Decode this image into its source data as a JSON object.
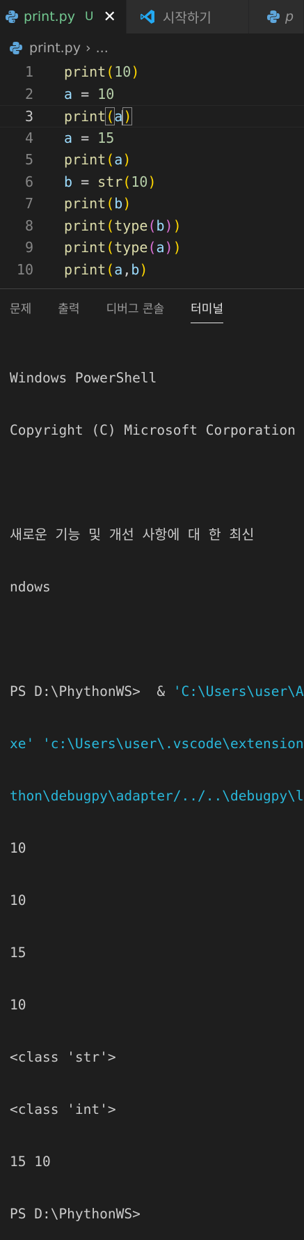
{
  "tabs": [
    {
      "label": "print.py",
      "status": "U",
      "active": true
    },
    {
      "label": "시작하기",
      "active": false
    },
    {
      "label": "p",
      "active": false
    }
  ],
  "breadcrumb": {
    "file": "print.py",
    "more": "..."
  },
  "editor": {
    "lines": [
      {
        "n": "1"
      },
      {
        "n": "2"
      },
      {
        "n": "3"
      },
      {
        "n": "4"
      },
      {
        "n": "5"
      },
      {
        "n": "6"
      },
      {
        "n": "7"
      },
      {
        "n": "8"
      },
      {
        "n": "9"
      },
      {
        "n": "10"
      }
    ]
  },
  "panel": {
    "tabs": [
      "문제",
      "출력",
      "디버그 콘솔",
      "터미널"
    ]
  },
  "terminal": {
    "l1": "Windows PowerShell",
    "l2": "Copyright (C) Microsoft Corporation",
    "l3": "새로운 기능 및 개선 사항에 대 한 최신",
    "l4": "ndows",
    "l5a": "PS D:\\PhythonWS>  & ",
    "l5b": "'C:\\Users\\user\\A",
    "l6a": "xe' ",
    "l6b": "'c:\\Users\\user\\.vscode\\extension",
    "l7": "thon\\debugpy\\adapter/../..\\debugpy\\l",
    "out": [
      "10",
      "10",
      "15",
      "10",
      "<class 'str'>",
      "<class 'int'>",
      "15 10"
    ],
    "prompt": "PS D:\\PhythonWS>"
  },
  "colors": {
    "accent_modified": "#73c991",
    "vscode_blue": "#0078d4"
  }
}
